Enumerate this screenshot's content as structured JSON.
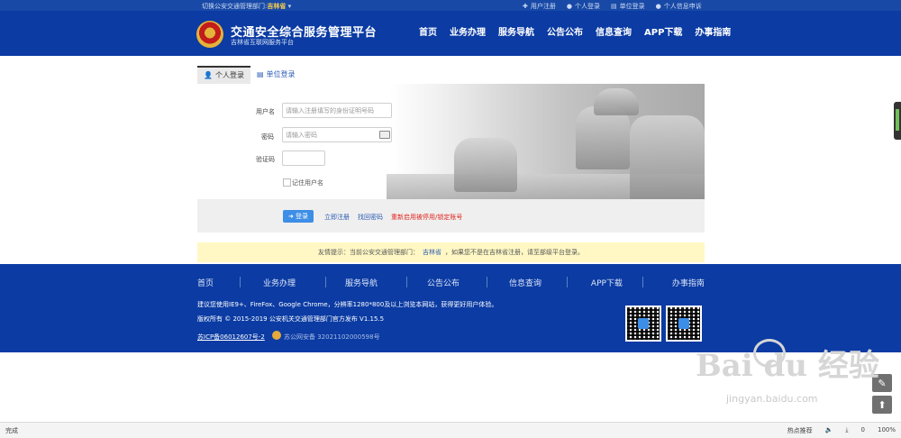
{
  "topbar": {
    "switch_prefix": "切换公安交通管理部门:",
    "switch_value": "吉林省",
    "links": [
      "用户注册",
      "个人登录",
      "单位登录",
      "个人信息申诉"
    ]
  },
  "header": {
    "title": "交通安全综合服务管理平台",
    "subtitle": "吉林省互联网服务平台",
    "nav": [
      "首页",
      "业务办理",
      "服务导航",
      "公告公布",
      "信息查询",
      "APP下载",
      "办事指南"
    ]
  },
  "tabs": {
    "personal": "个人登录",
    "unit": "单位登录"
  },
  "form": {
    "username_label": "用户名",
    "username_placeholder": "请输入注册填写的身份证明号码",
    "password_label": "密码",
    "password_placeholder": "请输入密码",
    "captcha_label": "验证码",
    "remember_label": "记住用户名",
    "login_button": "登录",
    "register_link": "立即注册",
    "retrieve_link": "找回密码",
    "reactivate_link": "重新启用被停用/锁定账号"
  },
  "tip": {
    "prefix": "友情提示：当前公安交通管理部门：",
    "dept": "吉林省",
    "suffix": "，如果您不是在吉林省注册，请至部级平台登录。"
  },
  "footer": {
    "nav": [
      "首页",
      "业务办理",
      "服务导航",
      "公告公布",
      "信息查询",
      "APP下载",
      "办事指南"
    ],
    "browser_note": "建议您使用IE9+、FireFox、Google Chrome，分辨率1280*800及以上浏览本网站，获得更好用户体验。",
    "copyright": "版权所有 © 2015-2019 公安机关交通管理部门官方发布 V1.15.5",
    "icp": "苏ICP备06012607号-2",
    "police_record": "苏公网安备 32021102000598号"
  },
  "watermark": {
    "brand": "Bai du 经验",
    "url": "jingyan.baidu.com"
  },
  "statusbar": {
    "left": "完成",
    "hot": "热点推荐",
    "count": "0",
    "zoom": "100%"
  }
}
